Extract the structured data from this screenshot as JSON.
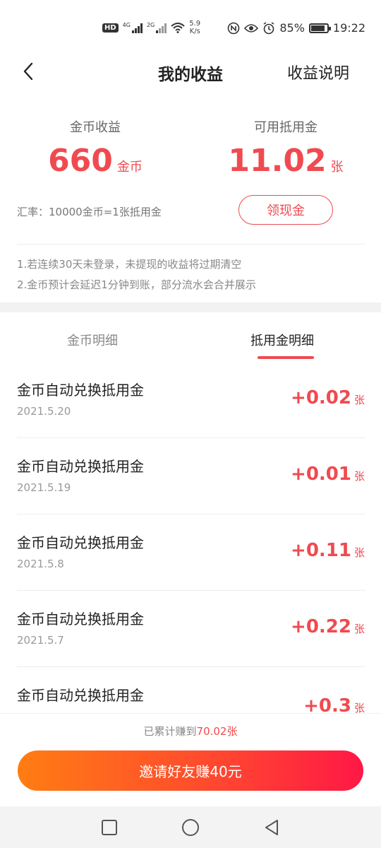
{
  "status_bar": {
    "hd": "HD",
    "net1": "4G",
    "net2": "2G",
    "speed_value": "5.9",
    "speed_unit": "K/s",
    "battery": "85%",
    "time": "19:22",
    "battery_level": 0.85
  },
  "header": {
    "title": "我的收益",
    "link": "收益说明"
  },
  "summary": {
    "coins_label": "金币收益",
    "coins_value": "660",
    "coins_unit": "金币",
    "voucher_label": "可用抵用金",
    "voucher_value": "11.02",
    "voucher_unit": "张",
    "rate_text": "汇率：10000金币=1张抵用金",
    "withdraw_button": "领现金"
  },
  "notes": [
    "1.若连续30天未登录，未提现的收益将过期清空",
    "2.金币预计会延迟1分钟到账，部分流水会合并展示"
  ],
  "tabs": [
    {
      "label": "金币明细",
      "active": false
    },
    {
      "label": "抵用金明细",
      "active": true
    }
  ],
  "records": [
    {
      "title": "金币自动兑换抵用金",
      "date": "2021.5.20",
      "amount": "+0.02",
      "unit": "张"
    },
    {
      "title": "金币自动兑换抵用金",
      "date": "2021.5.19",
      "amount": "+0.01",
      "unit": "张"
    },
    {
      "title": "金币自动兑换抵用金",
      "date": "2021.5.8",
      "amount": "+0.11",
      "unit": "张"
    },
    {
      "title": "金币自动兑换抵用金",
      "date": "2021.5.7",
      "amount": "+0.22",
      "unit": "张"
    },
    {
      "title": "金币自动兑换抵用金",
      "date": "",
      "amount": "+0.3",
      "unit": "张"
    }
  ],
  "footer": {
    "total_prefix": "已累计赚到",
    "total_value": "70.02张",
    "invite_button": "邀请好友赚40元"
  },
  "colors": {
    "accent": "#f04a50",
    "gradient_start": "#ff7d12",
    "gradient_end": "#ff1846"
  },
  "icons": {
    "back": "chevron-left-icon",
    "nav_recent": "square-icon",
    "nav_home": "circle-icon",
    "nav_back": "triangle-back-icon"
  }
}
